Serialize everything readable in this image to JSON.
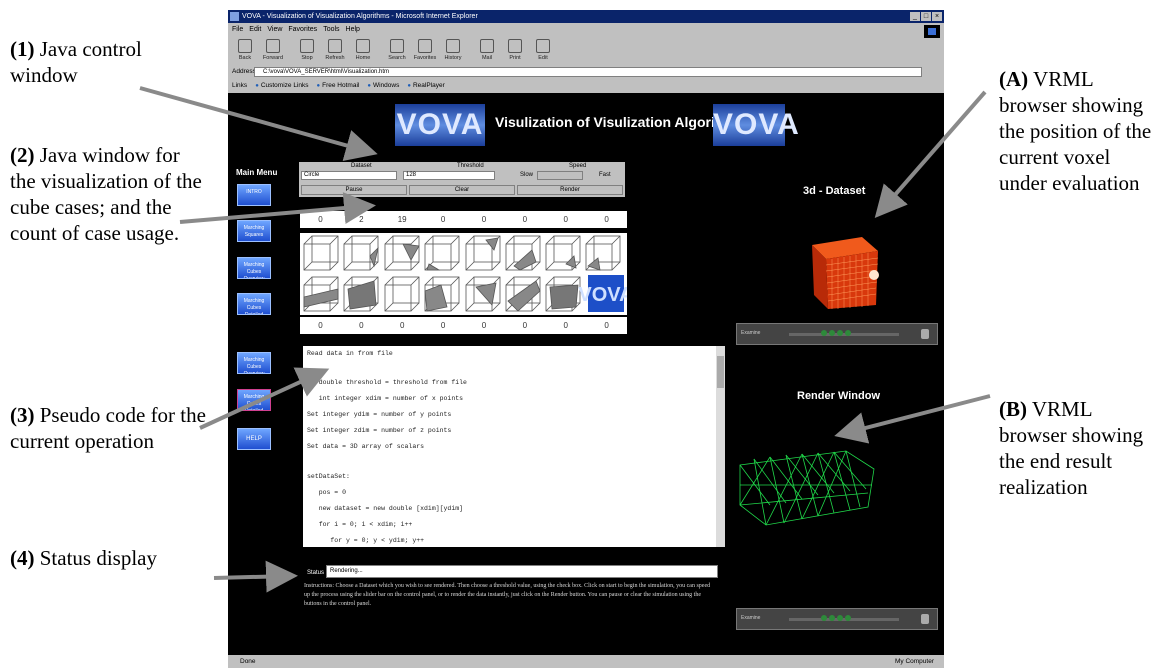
{
  "annotations": {
    "a1_num": "(1)",
    "a1_text": "Java control window",
    "a2_num": "(2)",
    "a2_text": "Java window for the visualization of the cube cases; and the count of case usage.",
    "a3_num": "(3)",
    "a3_text": "Pseudo code for the current operation",
    "a4_num": "(4)",
    "a4_text": "Status display",
    "aA_num": "(A)",
    "aA_text": "VRML browser showing the position of the current voxel under evaluation",
    "aB_num": "(B)",
    "aB_text": "VRML browser showing the end result realization"
  },
  "browser": {
    "title": "VOVA - Visualization of Visualization Algorithms - Microsoft Internet Explorer",
    "window_buttons": [
      "_",
      "□",
      "×"
    ],
    "menu": [
      "File",
      "Edit",
      "View",
      "Favorites",
      "Tools",
      "Help"
    ],
    "toolbar": [
      "Back",
      "Forward",
      "Stop",
      "Refresh",
      "Home",
      "Search",
      "Favorites",
      "History",
      "Mail",
      "Print",
      "Edit"
    ],
    "address_label": "Address",
    "address_value": "C:\\vova\\VOVA_SERVER\\html\\Visualization.htm",
    "links_label": "Links",
    "links": [
      "Customize Links",
      "Free Hotmail",
      "Windows",
      "RealPlayer"
    ],
    "status_left": "Done",
    "status_right": "My Computer"
  },
  "page": {
    "logo": "VOVA",
    "banner": "Visulization of Visulization Algorithms",
    "main_menu_title": "Main Menu",
    "menu_items": [
      "INTRO",
      "Marching Squares",
      "Marching Cubes Overview",
      "Marching Cubes Detailed",
      "Marching Cubes Overview",
      "Marching Cubes Detailed",
      "HELP"
    ],
    "controls": {
      "dataset_label": "Dataset",
      "dataset_value": "Circle",
      "threshold_label": "Threshold",
      "threshold_value": "128",
      "speed_label": "Speed",
      "slow_label": "Slow",
      "fast_label": "Fast",
      "pause_label": "Pause",
      "clear_label": "Clear",
      "render_label": "Render"
    },
    "counts_top": [
      "0",
      "2",
      "19",
      "0",
      "0",
      "0",
      "0",
      "0"
    ],
    "counts_bottom": [
      "0",
      "0",
      "0",
      "0",
      "0",
      "0",
      "0",
      "0"
    ],
    "code_lines": [
      "Read data in from file",
      "",
      "   double threshold = threshold from file",
      "   int integer xdim = number of x points",
      "Set integer ydim = number of y points",
      "Set integer zdim = number of z points",
      "Set data = 3D array of scalars",
      "",
      "setDataSet:",
      "   pos = 0",
      "   new dataset = new double [xdim][ydim]",
      "   for i = 0; i < xdim; i++",
      "      for y = 0; y < ydim; y++"
    ],
    "status_label": "Status",
    "status_value": "Rendering...",
    "instructions": "Instructions: Choose a Dataset which you wish to see rendered. Then choose a threshold value, using the check box. Click on start to begin the simulation, you can speed up the process using the slider bar on the control panel, or to render the data instantly, just click on the Render button. You can pause or clear the simulation using the buttons in the control panel.",
    "vrml_top_title": "3d - Dataset",
    "vrml_bottom_title": "Render Window",
    "vrml_nav_label": "Examine"
  },
  "colors": {
    "page_bg": "#000000",
    "ie_chrome": "#c0c0c0",
    "titlebar": "#0a246a",
    "voxel_red": "#e8400f",
    "render_green": "#1fd84a",
    "menu_button": "#2f66e8"
  }
}
